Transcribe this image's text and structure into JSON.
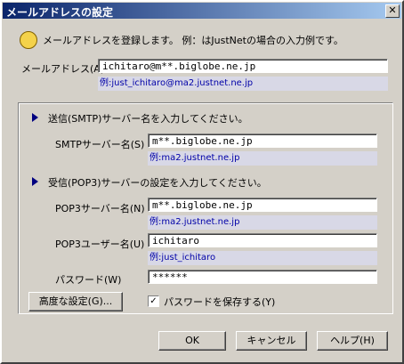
{
  "window": {
    "title": "メールアドレスの設定",
    "close_glyph": "✕"
  },
  "intro": {
    "text": "メールアドレスを登録します。 例：はJustNetの場合の入力例です。"
  },
  "mail": {
    "label": "メールアドレス(A)",
    "value": "ichitaro@m**.biglobe.ne.jp",
    "example": "例:just_ichitaro@ma2.justnet.ne.jp"
  },
  "smtp": {
    "heading": "送信(SMTP)サーバー名を入力してください。",
    "label": "SMTPサーバー名(S)",
    "value": "m**.biglobe.ne.jp",
    "example": "例:ma2.justnet.ne.jp"
  },
  "pop3": {
    "heading": "受信(POP3)サーバーの設定を入力してください。",
    "server_label": "POP3サーバー名(N)",
    "server_value": "m**.biglobe.ne.jp",
    "server_example": "例:ma2.justnet.ne.jp",
    "user_label": "POP3ユーザー名(U)",
    "user_value": "ichitaro",
    "user_example": "例:just_ichitaro",
    "password_label": "パスワード(W)",
    "password_value": "******"
  },
  "advanced_button": "高度な設定(G)...",
  "save_password": {
    "label": "パスワードを保存する(Y)",
    "checked": true,
    "check_glyph": "✓"
  },
  "buttons": {
    "ok": "OK",
    "cancel": "キャンセル",
    "help": "ヘルプ(H)"
  },
  "colors": {
    "titlebar_start": "#0a246a",
    "titlebar_end": "#a6caf0",
    "example_text": "#0000a8",
    "example_bg": "#d8d8e6",
    "arrow": "#000080"
  },
  "icons": {
    "intro_icon": "hand-pointer-icon",
    "section_arrow": "triangle-right-icon"
  }
}
